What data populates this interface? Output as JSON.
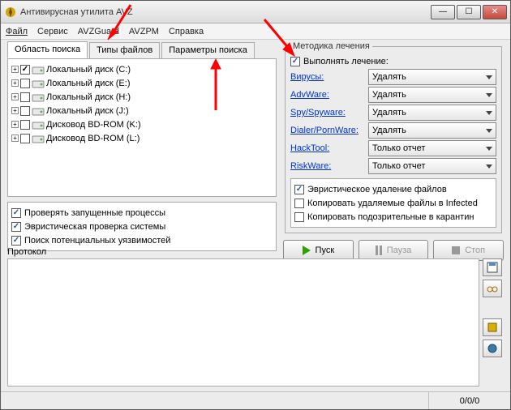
{
  "window": {
    "title": "Антивирусная утилита AVZ"
  },
  "menu": {
    "file": "Файл",
    "service": "Сервис",
    "avzguard": "AVZGuard",
    "avzpm": "AVZPM",
    "help": "Справка"
  },
  "tabs": {
    "area": "Область поиска",
    "types": "Типы файлов",
    "params": "Параметры поиска"
  },
  "drives": [
    {
      "label": "Локальный диск (C:)",
      "checked": true
    },
    {
      "label": "Локальный диск (E:)",
      "checked": false
    },
    {
      "label": "Локальный диск (H:)",
      "checked": false
    },
    {
      "label": "Локальный диск (J:)",
      "checked": false
    },
    {
      "label": "Дисковод BD-ROM (K:)",
      "checked": false
    },
    {
      "label": "Дисковод BD-ROM (L:)",
      "checked": false
    }
  ],
  "leftopts": {
    "proc": "Проверять запущенные процессы",
    "heur": "Эвристическая проверка системы",
    "vuln": "Поиск потенциальных уязвимостей"
  },
  "treat": {
    "legend": "Методика лечения",
    "perform": "Выполнять лечение:",
    "rows": {
      "virus": {
        "label": "Вирусы:",
        "value": "Удалять"
      },
      "advware": {
        "label": "AdvWare:",
        "value": "Удалять"
      },
      "spy": {
        "label": "Spy/Spyware:",
        "value": "Удалять"
      },
      "dialer": {
        "label": "Dialer/PornWare:",
        "value": "Удалять"
      },
      "hack": {
        "label": "HackTool:",
        "value": "Только отчет"
      },
      "risk": {
        "label": "RiskWare:",
        "value": "Только отчет"
      }
    },
    "opts": {
      "heurdel": "Эвристическое удаление файлов",
      "copyinf": "Копировать удаляемые файлы в Infected",
      "copyq": "Копировать подозрительные в карантин"
    }
  },
  "buttons": {
    "start": "Пуск",
    "pause": "Пауза",
    "stop": "Стоп"
  },
  "protocol_label": "Протокол",
  "status": {
    "counts": "0/0/0"
  }
}
